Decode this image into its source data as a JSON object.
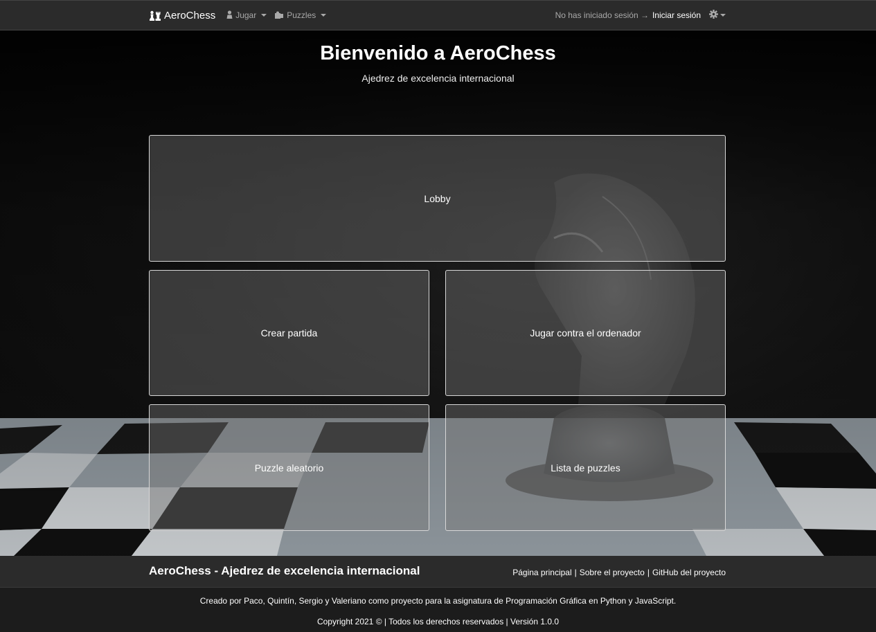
{
  "navbar": {
    "brand": "AeroChess",
    "brand_icon": "chess-pieces-icon",
    "jugar_label": "Jugar",
    "jugar_icon": "person-icon",
    "puzzles_label": "Puzzles",
    "puzzles_icon": "puzzle-icon",
    "login_status": "No has iniciado sesión →",
    "login_link": "Iniciar sesión",
    "settings_icon": "gear-icon"
  },
  "hero": {
    "title": "Bienvenido a AeroChess",
    "subtitle": "Ajedrez de excelencia internacional",
    "cards": {
      "lobby": "Lobby",
      "crear": "Crear partida",
      "ordenador": "Jugar contra el ordenador",
      "puzzle": "Puzzle aleatorio",
      "lista": "Lista de puzzles"
    }
  },
  "footer": {
    "title": "AeroChess - Ajedrez de excelencia internacional",
    "links": {
      "home": "Página principal",
      "sep1": "|",
      "about": "Sobre el proyecto",
      "sep2": "|",
      "github": "GitHub del proyecto"
    },
    "credits": "Creado por Paco, Quintín, Sergio y Valeriano como proyecto para la asignatura de Programación Gráfica en Python y JavaScript.",
    "copyright": "Copyright 2021 © | Todos los derechos reservados | Versión 1.0.0"
  },
  "colors": {
    "navbar_bg": "#2b2b2b",
    "card_bg": "rgba(120,120,120,0.42)",
    "card_border": "#d8d8d8",
    "footer_bg": "#1c1c1c"
  }
}
